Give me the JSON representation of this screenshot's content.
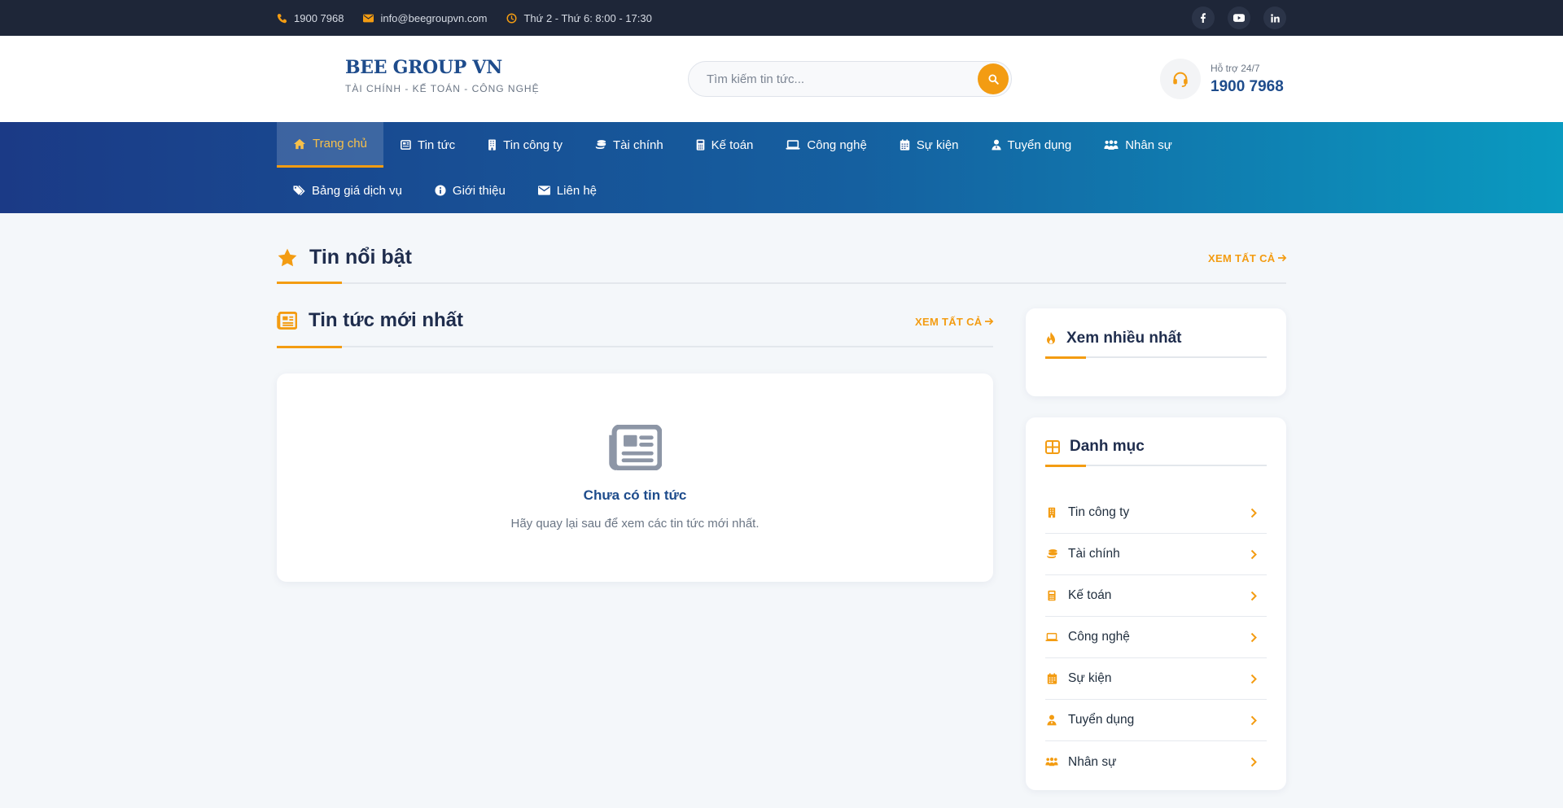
{
  "topbar": {
    "phone": "1900 7968",
    "email": "info@beegroupvn.com",
    "hours": "Thứ 2 - Thứ 6: 8:00 - 17:30",
    "social": [
      "facebook-icon",
      "youtube-icon",
      "linkedin-icon"
    ]
  },
  "header": {
    "logo_name": "BEE GROUP VN",
    "logo_tagline": "TÀI CHÍNH - KẾ TOÁN - CÔNG NGHỆ",
    "search_placeholder": "Tìm kiếm tin tức...",
    "support_label": "Hỗ trợ 24/7",
    "support_phone": "1900 7968"
  },
  "nav": {
    "row1": [
      {
        "label": "Trang chủ",
        "icon": "home-icon",
        "active": true
      },
      {
        "label": "Tin tức",
        "icon": "newspaper-icon"
      },
      {
        "label": "Tin công ty",
        "icon": "building-icon"
      },
      {
        "label": "Tài chính",
        "icon": "coins-icon"
      },
      {
        "label": "Kế toán",
        "icon": "calculator-icon"
      },
      {
        "label": "Công nghệ",
        "icon": "laptop-icon"
      },
      {
        "label": "Sự kiện",
        "icon": "calendar-icon"
      },
      {
        "label": "Tuyển dụng",
        "icon": "user-tie-icon"
      },
      {
        "label": "Nhân sự",
        "icon": "users-icon"
      }
    ],
    "row2": [
      {
        "label": "Bảng giá dịch vụ",
        "icon": "tags-icon"
      },
      {
        "label": "Giới thiệu",
        "icon": "info-icon"
      },
      {
        "label": "Liên hệ",
        "icon": "envelope-icon"
      }
    ]
  },
  "featured": {
    "title": "Tin nổi bật",
    "see_all": "XEM TẤT CẢ"
  },
  "latest": {
    "title": "Tin tức mới nhất",
    "see_all": "XEM TẤT CẢ",
    "empty_title": "Chưa có tin tức",
    "empty_sub": "Hãy quay lại sau để xem các tin tức mới nhất."
  },
  "sidebar": {
    "most_viewed_title": "Xem nhiều nhất",
    "categories_title": "Danh mục",
    "categories": [
      {
        "label": "Tin công ty",
        "icon": "building-icon"
      },
      {
        "label": "Tài chính",
        "icon": "coins-icon"
      },
      {
        "label": "Kế toán",
        "icon": "calculator-icon"
      },
      {
        "label": "Công nghệ",
        "icon": "laptop-icon"
      },
      {
        "label": "Sự kiện",
        "icon": "calendar-icon"
      },
      {
        "label": "Tuyển dụng",
        "icon": "user-tie-icon"
      },
      {
        "label": "Nhân sự",
        "icon": "users-icon"
      }
    ]
  },
  "colors": {
    "accent": "#f39c12",
    "brand": "#1e4c8c",
    "topbar_bg": "#1e2638"
  }
}
